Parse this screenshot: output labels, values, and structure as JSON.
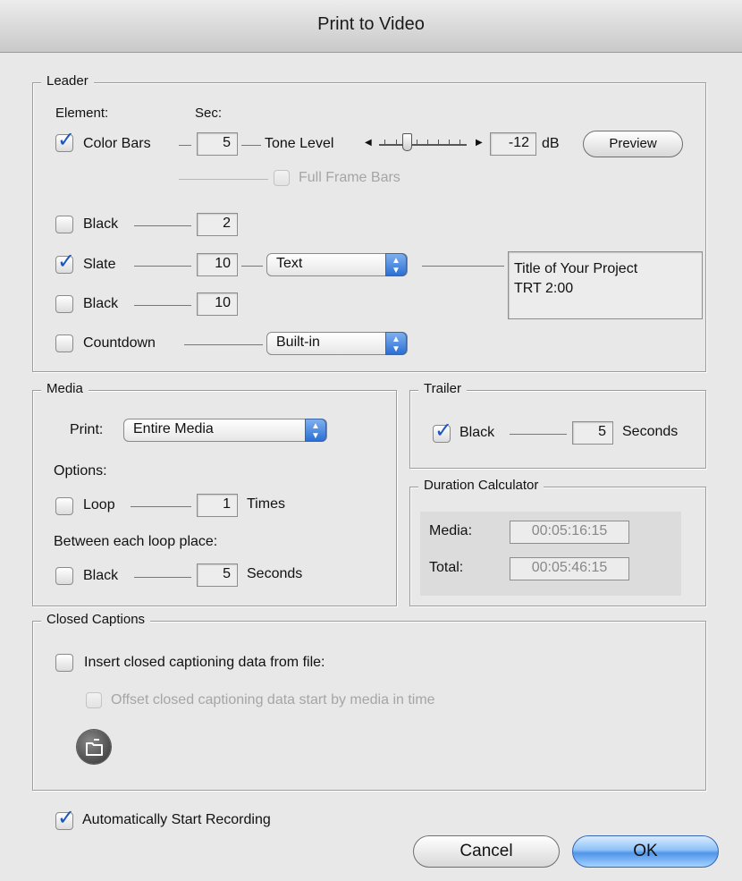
{
  "window": {
    "title": "Print to Video"
  },
  "leader": {
    "legend": "Leader",
    "element_header": "Element:",
    "sec_header": "Sec:",
    "color_bars": {
      "label": "Color Bars",
      "checked": true,
      "seconds": "5"
    },
    "tone_level": {
      "label": "Tone Level",
      "value": "-12",
      "unit": "dB"
    },
    "preview_label": "Preview",
    "full_frame_bars": {
      "label": "Full Frame Bars",
      "checked": false,
      "enabled": false
    },
    "black1": {
      "label": "Black",
      "checked": false,
      "seconds": "2"
    },
    "slate": {
      "label": "Slate",
      "checked": true,
      "seconds": "10",
      "source": "Text",
      "text_line1": "Title of Your Project",
      "text_line2": "TRT 2:00"
    },
    "black2": {
      "label": "Black",
      "checked": false,
      "seconds": "10"
    },
    "countdown": {
      "label": "Countdown",
      "checked": false,
      "source": "Built-in"
    }
  },
  "media": {
    "legend": "Media",
    "print_label": "Print:",
    "print_value": "Entire Media",
    "options_label": "Options:",
    "loop": {
      "label": "Loop",
      "checked": false,
      "times": "1",
      "unit": "Times"
    },
    "between_label": "Between each loop place:",
    "black": {
      "label": "Black",
      "checked": false,
      "seconds": "5",
      "unit": "Seconds"
    }
  },
  "trailer": {
    "legend": "Trailer",
    "black": {
      "label": "Black",
      "checked": true,
      "seconds": "5",
      "unit": "Seconds"
    }
  },
  "duration": {
    "legend": "Duration Calculator",
    "media_label": "Media:",
    "media_value": "00:05:16:15",
    "total_label": "Total:",
    "total_value": "00:05:46:15"
  },
  "captions": {
    "legend": "Closed Captions",
    "insert": {
      "label": "Insert closed captioning data from file:",
      "checked": false
    },
    "offset": {
      "label": "Offset closed captioning data start by media in time",
      "checked": false,
      "enabled": false
    }
  },
  "auto_record": {
    "label": "Automatically Start Recording",
    "checked": true
  },
  "buttons": {
    "cancel": "Cancel",
    "ok": "OK"
  },
  "colors": {
    "accent": "#2a6fd6",
    "check": "#1a55c2"
  },
  "icons": {
    "folder": "folder-icon",
    "checkmark": "checkmark-icon"
  }
}
